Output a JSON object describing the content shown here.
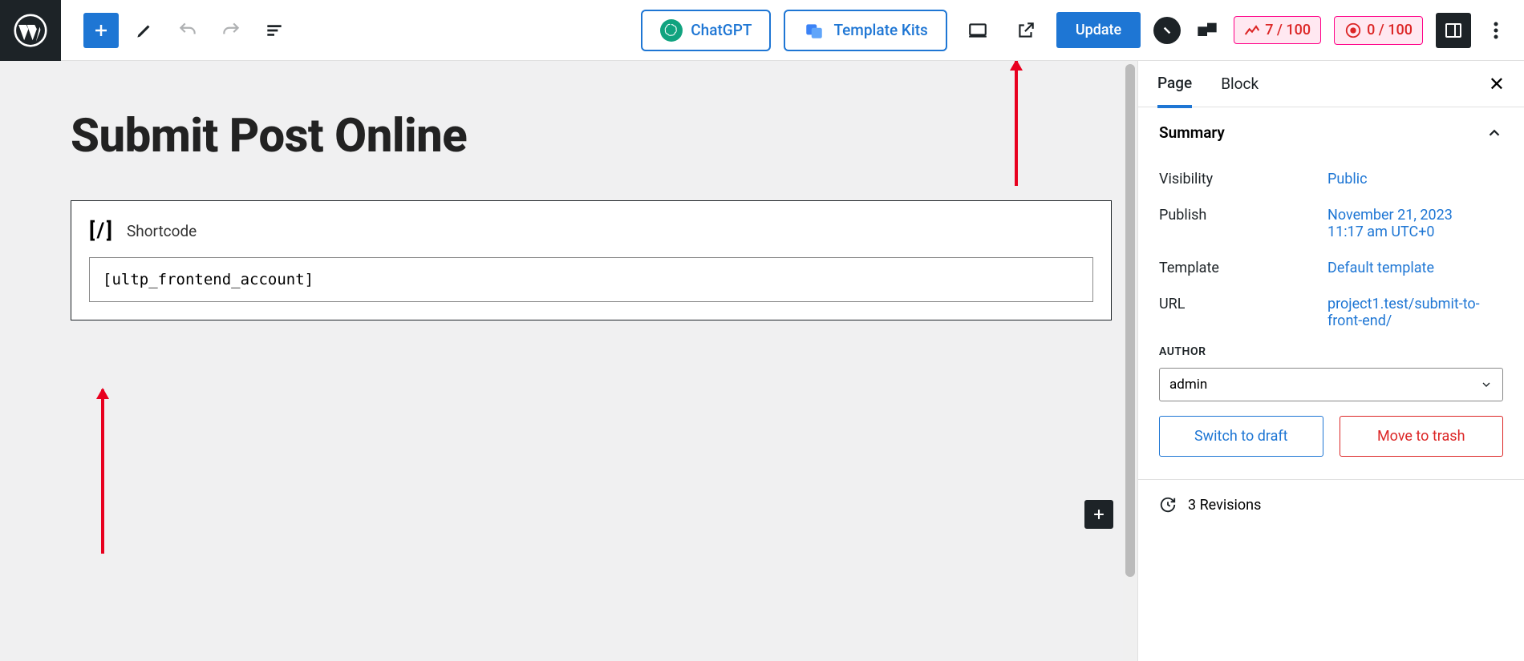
{
  "toolbar": {
    "chatgpt_label": "ChatGPT",
    "template_kits_label": "Template Kits",
    "update_label": "Update",
    "badge1": "7 / 100",
    "badge2": "0 / 100"
  },
  "page": {
    "title": "Submit Post Online"
  },
  "shortcode": {
    "label": "Shortcode",
    "value": "[ultp_frontend_account]"
  },
  "sidebar": {
    "tabs": {
      "page": "Page",
      "block": "Block"
    },
    "summary": {
      "title": "Summary",
      "visibility": {
        "label": "Visibility",
        "value": "Public"
      },
      "publish": {
        "label": "Publish",
        "date": "November 21, 2023",
        "time": "11:17 am UTC+0"
      },
      "template": {
        "label": "Template",
        "value": "Default template"
      },
      "url": {
        "label": "URL",
        "value": "project1.test/submit-to-front-end/"
      },
      "author": {
        "label": "AUTHOR",
        "value": "admin"
      },
      "switch_draft": "Switch to draft",
      "move_trash": "Move to trash"
    },
    "revisions": {
      "count": "3 Revisions"
    }
  }
}
